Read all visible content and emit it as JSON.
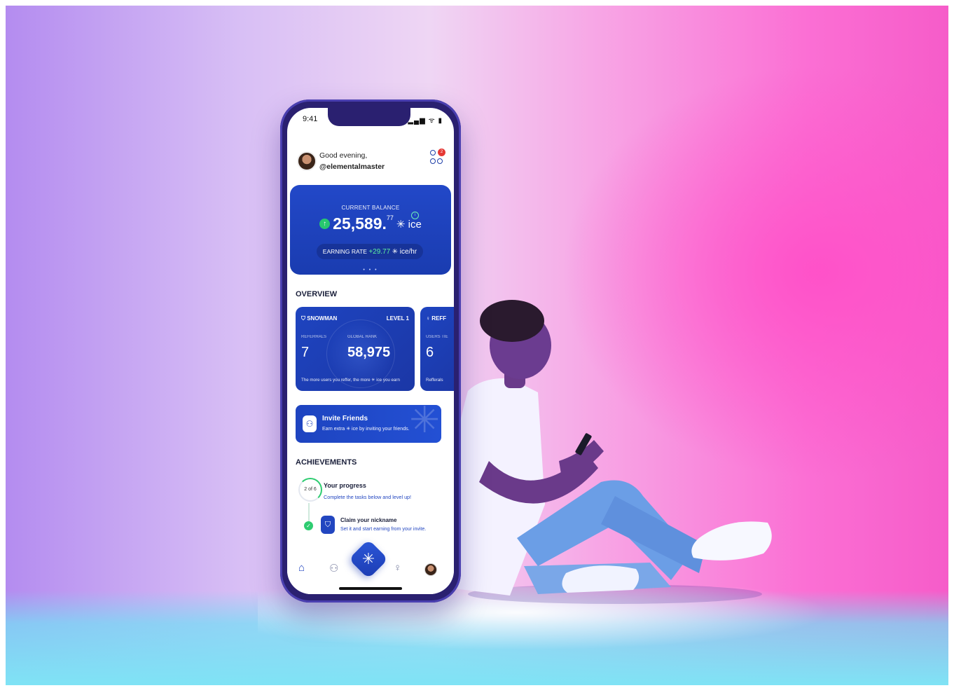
{
  "status": {
    "time": "9:41",
    "icons": "▂▄▆ ᯤ ▮"
  },
  "header": {
    "greeting": "Good evening,",
    "username": "@elementalmaster",
    "notif_count": "2"
  },
  "balance": {
    "label": "CURRENT BALANCE",
    "arrow": "↑",
    "main": "25,589.",
    "decimals": "77",
    "unit": "✳ ice",
    "info": "i"
  },
  "rate": {
    "label": "EARNING RATE",
    "value": "+29.77",
    "unit": "✳ ice/hr"
  },
  "carousel_dots": "• • •",
  "overview": {
    "title": "OVERVIEW",
    "card1": {
      "title": "⛉ SNOWMAN",
      "level": "LEVEL 1",
      "referrals_label": "REFERRALS",
      "rank_label": "GLOBAL RANK",
      "referrals": "7",
      "rank": "58,975",
      "note": "The more users you reffer, the more ✳ ice you earn"
    },
    "card2": {
      "title": "♀ REFF",
      "label": "USERS TIE",
      "value": "6",
      "note": "Refferals"
    }
  },
  "invite": {
    "title": "Invite Friends",
    "subtitle": "Earn extra ✳ ice by inviting your friends.",
    "icon": "⚇"
  },
  "achievements": {
    "title": "ACHIEVEMENTS",
    "progress_ring": "2 of 6",
    "progress_title": "Your progress",
    "progress_subtitle": "Complete the tasks below and level up!",
    "task_title": "Claim your nickname",
    "task_subtitle": "Set it and start earning from your invite.",
    "task_check": "✓",
    "task_icon": "⛉"
  },
  "tabbar": {
    "home_icon": "⌂",
    "team_icon": "⚇",
    "center_icon": "✳",
    "bulb_icon": "♀"
  },
  "colors": {
    "brand_blue": "#1e44c0",
    "accent_green": "#2ecc71",
    "bg_pink": "#fb6fd4",
    "bg_violet": "#b48cf0",
    "floor_cyan": "#7fe3f5"
  }
}
